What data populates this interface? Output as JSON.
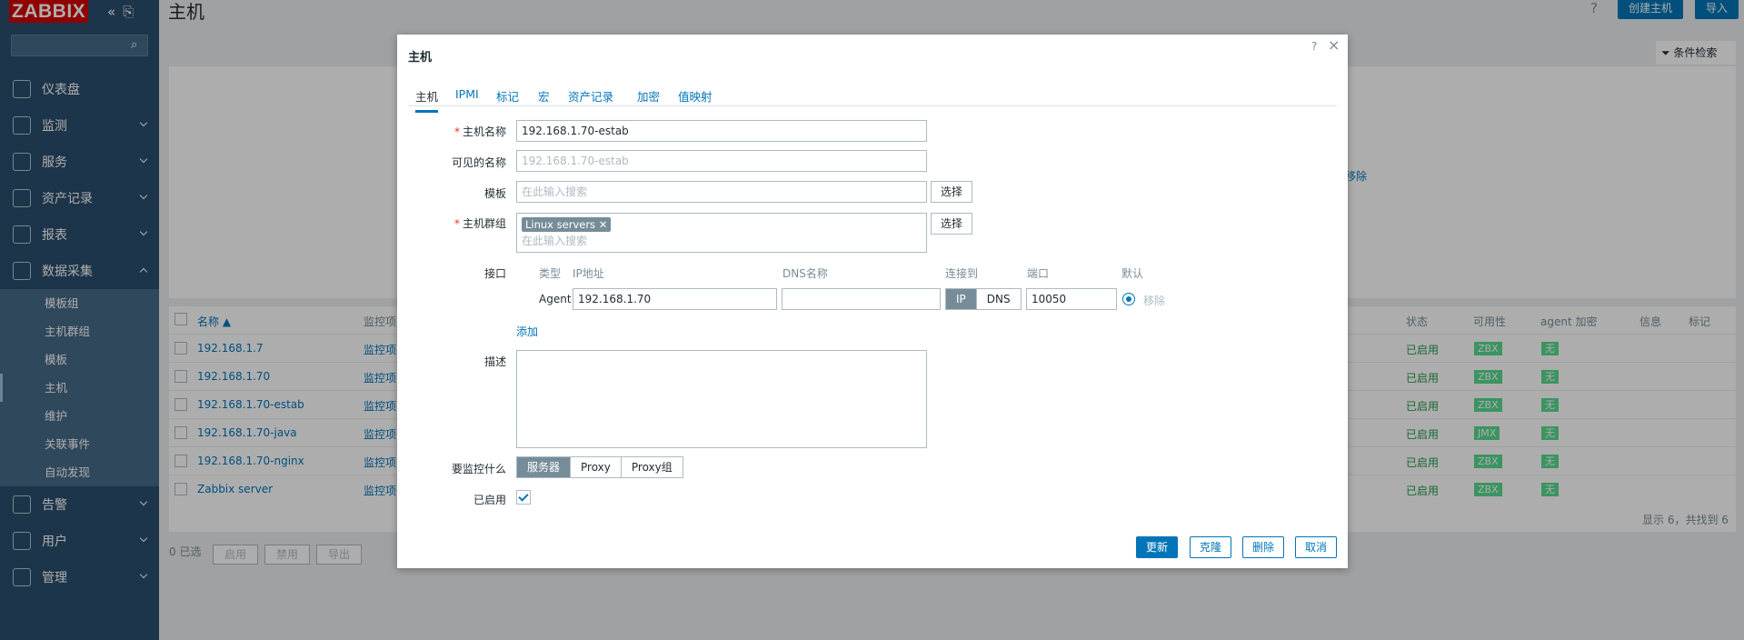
{
  "app": {
    "logo": "ZABBIX",
    "page_title": "主机"
  },
  "sidebar": {
    "menu": [
      {
        "label": "仪表盘",
        "icon": "dashboard-icon"
      },
      {
        "label": "监测",
        "icon": "monitoring-icon"
      },
      {
        "label": "服务",
        "icon": "services-icon"
      },
      {
        "label": "资产记录",
        "icon": "inventory-icon"
      },
      {
        "label": "报表",
        "icon": "reports-icon"
      },
      {
        "label": "数据采集",
        "icon": "data-collection-icon"
      }
    ],
    "submenu": [
      "模板组",
      "主机群组",
      "模板",
      "主机",
      "维护",
      "关联事件",
      "自动发现"
    ],
    "menu_bottom": [
      {
        "label": "告警",
        "icon": "alerts-icon"
      },
      {
        "label": "用户",
        "icon": "users-icon"
      },
      {
        "label": "管理",
        "icon": "administration-icon"
      }
    ]
  },
  "header": {
    "help": "?",
    "create_host": "创建主机",
    "import": "导入",
    "filter_tab": "条件检索"
  },
  "table": {
    "columns": [
      "名称 ▲",
      "监控项",
      "状态",
      "可用性",
      "agent 加密",
      "信息",
      "标记"
    ],
    "rows": [
      {
        "name": "192.168.1.7",
        "items": "监控项",
        "status": "已启用",
        "avail": "ZBX",
        "enc": "无"
      },
      {
        "name": "192.168.1.70",
        "items": "监控项",
        "status": "已启用",
        "avail": "ZBX",
        "enc": "无"
      },
      {
        "name": "192.168.1.70-estab",
        "items": "监控项",
        "status": "已启用",
        "avail": "ZBX",
        "enc": "无"
      },
      {
        "name": "192.168.1.70-java",
        "items": "监控项",
        "status": "已启用",
        "avail": "JMX",
        "enc": "无"
      },
      {
        "name": "192.168.1.70-nginx",
        "items": "监控项",
        "status": "已启用",
        "avail": "ZBX",
        "enc": "无"
      },
      {
        "name": "Zabbix server",
        "items": "监控项",
        "status": "已启用",
        "avail": "ZBX",
        "enc": "无"
      }
    ],
    "footer": "显示 6，共找到 6",
    "selected": "0 已选",
    "mass": [
      "启用",
      "禁用",
      "导出"
    ],
    "behind_text": "移除"
  },
  "modal": {
    "title": "主机",
    "help": "?",
    "close": "×",
    "tabs": [
      "主机",
      "IPMI",
      "标记",
      "宏",
      "资产记录",
      "加密",
      "值映射"
    ],
    "labels": {
      "host_name": "主机名称",
      "visible_name": "可见的名称",
      "templates": "模板",
      "host_groups": "主机群组",
      "interfaces": "接口",
      "description": "描述",
      "monitored_by": "要监控什么",
      "enabled": "已启用"
    },
    "host_name": "192.168.1.70-estab",
    "visible_name": "192.168.1.70-estab",
    "templates_placeholder": "在此输入搜索",
    "groups_placeholder": "在此输入搜索",
    "group_chip": "Linux servers",
    "select_btn": "选择",
    "interface_headers": [
      "类型",
      "IP地址",
      "DNS名称",
      "连接到",
      "端口",
      "默认"
    ],
    "interface": {
      "type": "Agent",
      "ip": "192.168.1.70",
      "dns": "",
      "connect_ip": "IP",
      "connect_dns": "DNS",
      "port": "10050",
      "remove": "移除"
    },
    "add_link": "添加",
    "monitored_by_options": [
      "服务器",
      "Proxy",
      "Proxy组"
    ],
    "buttons": {
      "update": "更新",
      "clone": "克隆",
      "delete": "删除",
      "cancel": "取消"
    }
  }
}
